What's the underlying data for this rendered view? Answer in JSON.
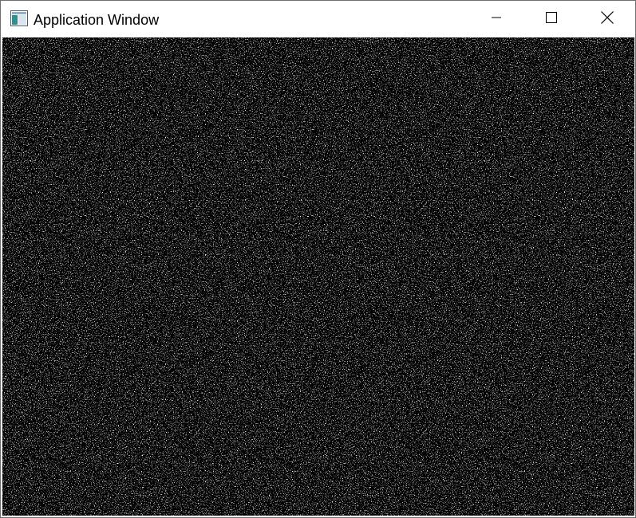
{
  "window": {
    "title": "Application Window",
    "icon": "app-window-icon",
    "controls": {
      "minimize_icon": "minimize-icon",
      "maximize_icon": "maximize-icon",
      "close_icon": "close-icon"
    }
  },
  "canvas": {
    "content": "random-noise",
    "background_color": "#000000",
    "pixel_color": "#ffffff"
  },
  "colors": {
    "titlebar_bg": "#ffffff",
    "title_text": "#000000",
    "border": "#6e6e6e",
    "close_hover": "#e81123"
  }
}
